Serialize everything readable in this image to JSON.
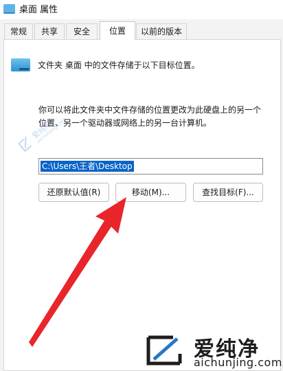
{
  "window": {
    "title": "桌面 属性"
  },
  "tabs": [
    {
      "label": "常规",
      "active": false
    },
    {
      "label": "共享",
      "active": false
    },
    {
      "label": "安全",
      "active": false
    },
    {
      "label": "位置",
      "active": true
    },
    {
      "label": "以前的版本",
      "active": false
    }
  ],
  "location": {
    "heading": "文件夹 桌面 中的文件存储于以下目标位置。",
    "description_line1": "你可以将此文件夹中文件存储的位置更改为此硬盘上的另一个",
    "description_line2": "位置、另一个驱动器或网络上的另一台计算机。",
    "path_value": "C:\\Users\\王者\\Desktop"
  },
  "buttons": {
    "restore_default": "还原默认值(R)",
    "move": "移动(M)...",
    "find_target": "查找目标(F)..."
  },
  "watermark": {
    "name": "爱纯净",
    "url": "aichunjing.com",
    "faint_name": "爱纯净",
    "faint_url": "aichunjing.com"
  },
  "colors": {
    "selection": "#0a64c8",
    "arrow": "#e8252a",
    "folder": "#4aa8e2"
  },
  "icons": {
    "title_icon": "desktop-folder-icon",
    "folder_icon": "desktop-folder-icon",
    "annotation": "red-arrow-pointer",
    "watermark_logo": "aichunjing-logo"
  }
}
